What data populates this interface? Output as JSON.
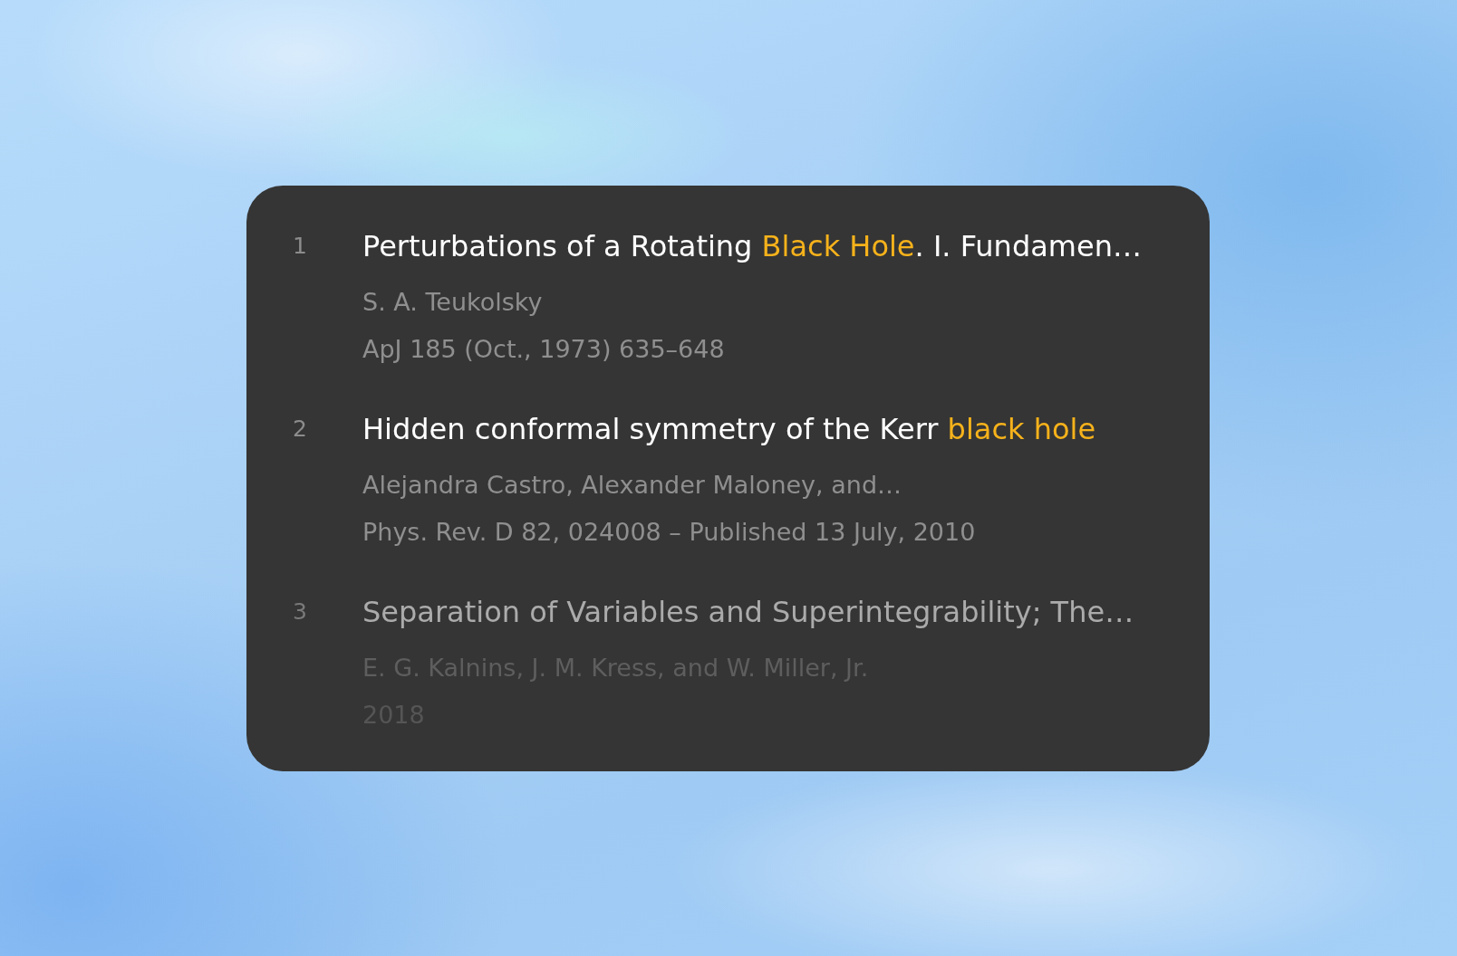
{
  "results": [
    {
      "number": "1",
      "title": [
        {
          "text": "Perturbations of a Rotating ",
          "highlight": false
        },
        {
          "text": "Black Hole",
          "highlight": true
        },
        {
          "text": ". I. Fundamen…",
          "highlight": false
        }
      ],
      "authors": "S. A. Teukolsky",
      "citation": "ApJ 185 (Oct., 1973) 635–648"
    },
    {
      "number": "2",
      "title": [
        {
          "text": "Hidden conformal symmetry of the Kerr ",
          "highlight": false
        },
        {
          "text": "black hole",
          "highlight": true
        }
      ],
      "authors": "Alejandra Castro, Alexander Maloney, and…",
      "citation": "Phys. Rev. D 82, 024008 – Published 13 July, 2010"
    },
    {
      "number": "3",
      "title": [
        {
          "text": "Separation of Variables and Superintegrability; The…",
          "highlight": false
        }
      ],
      "authors": "E. G. Kalnins, J. M. Kress, and W. Miller, Jr.",
      "citation": "2018"
    }
  ]
}
